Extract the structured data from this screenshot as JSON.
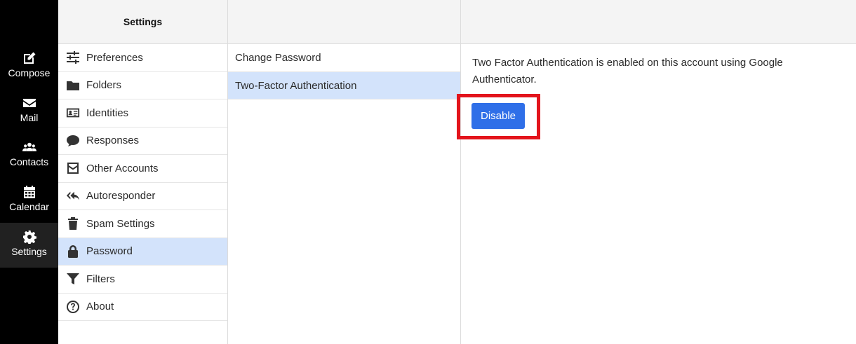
{
  "rail": {
    "items": [
      {
        "label": "Compose",
        "icon": "compose-icon"
      },
      {
        "label": "Mail",
        "icon": "mail-icon"
      },
      {
        "label": "Contacts",
        "icon": "contacts-icon"
      },
      {
        "label": "Calendar",
        "icon": "calendar-icon"
      },
      {
        "label": "Settings",
        "icon": "gear-icon",
        "active": true
      }
    ]
  },
  "settings": {
    "title": "Settings",
    "items": [
      {
        "label": "Preferences",
        "icon": "sliders-icon"
      },
      {
        "label": "Folders",
        "icon": "folder-icon"
      },
      {
        "label": "Identities",
        "icon": "id-card-icon"
      },
      {
        "label": "Responses",
        "icon": "speech-bubble-icon"
      },
      {
        "label": "Other Accounts",
        "icon": "envelope-square-icon"
      },
      {
        "label": "Autoresponder",
        "icon": "reply-all-icon"
      },
      {
        "label": "Spam Settings",
        "icon": "trash-icon"
      },
      {
        "label": "Password",
        "icon": "lock-icon",
        "active": true
      },
      {
        "label": "Filters",
        "icon": "filter-icon"
      },
      {
        "label": "About",
        "icon": "question-circle-icon"
      }
    ]
  },
  "password": {
    "items": [
      {
        "label": "Change Password"
      },
      {
        "label": "Two-Factor Authentication",
        "active": true
      }
    ]
  },
  "content": {
    "message": "Two Factor Authentication is enabled on this account using Google Authenticator.",
    "disable_label": "Disable"
  },
  "colors": {
    "rail_bg": "#000000",
    "active_row": "#d3e3fb",
    "button": "#2f6fe8",
    "highlight": "#e3141c"
  }
}
